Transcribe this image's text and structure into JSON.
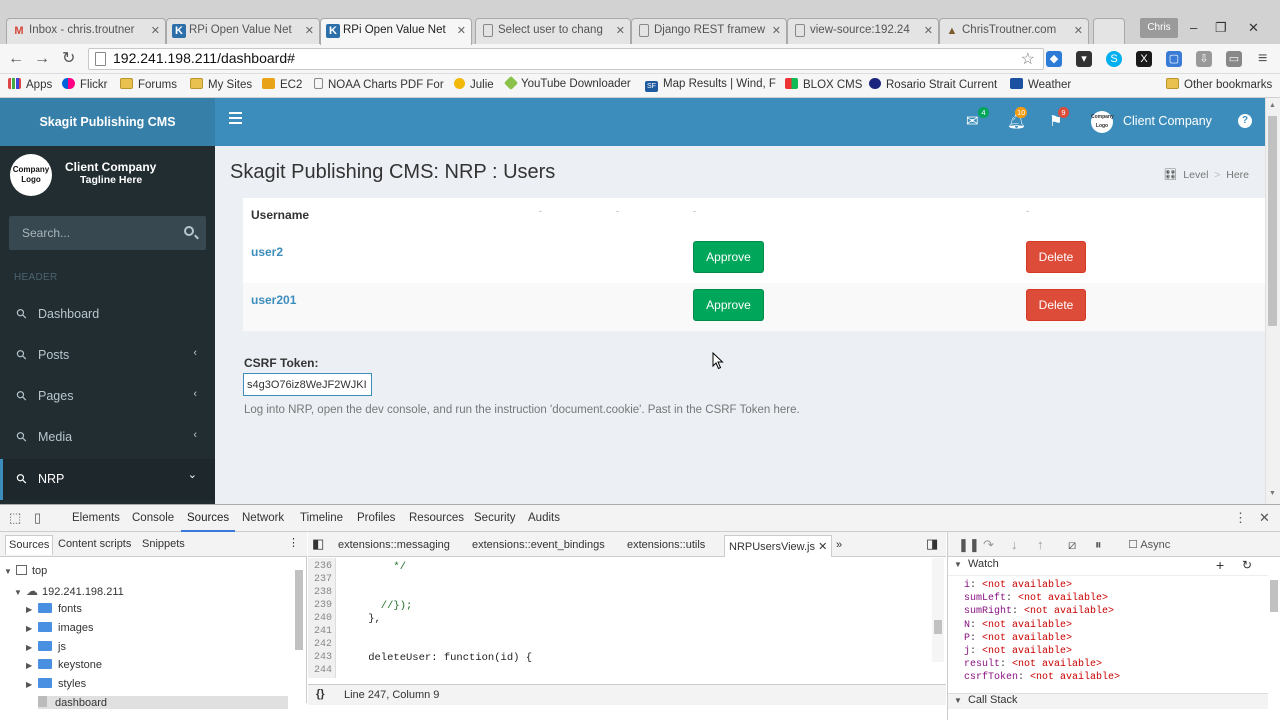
{
  "browser": {
    "tabs": [
      {
        "label": "Inbox - chris.troutner",
        "icon": "gmail-icon",
        "active": false
      },
      {
        "label": "RPi Open Value Net",
        "icon": "k-icon",
        "active": false
      },
      {
        "label": "RPi Open Value Net",
        "icon": "k-icon",
        "active": true
      },
      {
        "label": "Select user to chang",
        "icon": "page-icon",
        "active": false
      },
      {
        "label": "Django REST framew",
        "icon": "page-icon",
        "active": false
      },
      {
        "label": "view-source:192.24",
        "icon": "page-icon",
        "active": false
      },
      {
        "label": "ChrisTroutner.com",
        "icon": "site-icon",
        "active": false
      }
    ],
    "window_user": "Chris",
    "address": "192.241.198.211/dashboard#",
    "bookmarks": [
      "Apps",
      "Flickr",
      "Forums",
      "My Sites",
      "EC2",
      "NOAA Charts PDF For",
      "Julie",
      "YouTube Downloader",
      "Map Results | Wind, F",
      "BLOX CMS",
      "Rosario Strait Current",
      "Weather"
    ],
    "other_bookmarks": "Other bookmarks"
  },
  "cms": {
    "brand": "Skagit Publishing CMS",
    "header": {
      "mail_count": "4",
      "notif_count": "10",
      "flag_count": "9",
      "avatar_text": "Company Logo",
      "user_name": "Client Company",
      "help_glyph": "?"
    },
    "sidebar": {
      "logo_text": "Company Logo",
      "company": "Client Company",
      "tagline": "Tagline Here",
      "search_placeholder": "Search...",
      "section_header": "HEADER",
      "items": [
        {
          "label": "Dashboard",
          "chevron": ""
        },
        {
          "label": "Posts",
          "chevron": "‹"
        },
        {
          "label": "Pages",
          "chevron": "‹"
        },
        {
          "label": "Media",
          "chevron": "‹"
        },
        {
          "label": "NRP",
          "chevron": "⌄"
        }
      ]
    },
    "content": {
      "title": "Skagit Publishing CMS: NRP : Users",
      "breadcrumb": [
        "Level",
        ">",
        "Here"
      ],
      "table": {
        "header": "Username",
        "dots": [
          "-",
          "-",
          "-",
          "-"
        ],
        "rows": [
          {
            "username": "user2",
            "approve": "Approve",
            "delete": "Delete"
          },
          {
            "username": "user201",
            "approve": "Approve",
            "delete": "Delete"
          }
        ]
      },
      "csrf_label": "CSRF Token:",
      "csrf_value": "s4g3O76iz8WeJF2WJKI",
      "help_text": "Log into NRP, open the dev console, and run the instruction 'document.cookie'. Past in the CSRF Token here."
    }
  },
  "devtools": {
    "tabs": [
      "Elements",
      "Console",
      "Sources",
      "Network",
      "Timeline",
      "Profiles",
      "Resources",
      "Security",
      "Audits"
    ],
    "active_tab": "Sources",
    "nav_tabs": [
      "Sources",
      "Content scripts",
      "Snippets"
    ],
    "tree": [
      {
        "label": "top",
        "level": 0,
        "type": "frame"
      },
      {
        "label": "192.241.198.211",
        "level": 1,
        "type": "cloud"
      },
      {
        "label": "fonts",
        "level": 2,
        "type": "folder"
      },
      {
        "label": "images",
        "level": 2,
        "type": "folder"
      },
      {
        "label": "js",
        "level": 2,
        "type": "folder"
      },
      {
        "label": "keystone",
        "level": 2,
        "type": "folder"
      },
      {
        "label": "styles",
        "level": 2,
        "type": "folder"
      },
      {
        "label": "dashboard",
        "level": 2,
        "type": "file"
      }
    ],
    "editor_tabs": [
      "extensions::messaging",
      "extensions::event_bindings",
      "extensions::utils",
      "NRPUsersView.js"
    ],
    "code_lines": [
      {
        "n": "236",
        "text": "        */"
      },
      {
        "n": "237",
        "text": ""
      },
      {
        "n": "238",
        "text": ""
      },
      {
        "n": "239",
        "text": "      //});"
      },
      {
        "n": "240",
        "text": "    },"
      },
      {
        "n": "241",
        "text": ""
      },
      {
        "n": "242",
        "text": ""
      },
      {
        "n": "243",
        "text": "    deleteUser: function(id) {"
      },
      {
        "n": "244",
        "text": ""
      }
    ],
    "status": "Line 247, Column 9",
    "status_icon": "{}",
    "async_label": "Async",
    "watch_title": "Watch",
    "watch": [
      {
        "name": "i",
        "value": "<not available>"
      },
      {
        "name": "sumLeft",
        "value": "<not available>"
      },
      {
        "name": "sumRight",
        "value": "<not available>"
      },
      {
        "name": "N",
        "value": "<not available>"
      },
      {
        "name": "P",
        "value": "<not available>"
      },
      {
        "name": "j",
        "value": "<not available>"
      },
      {
        "name": "result",
        "value": "<not available>"
      },
      {
        "name": "csrfToken",
        "value": "<not available>"
      }
    ],
    "call_stack": "Call Stack"
  }
}
